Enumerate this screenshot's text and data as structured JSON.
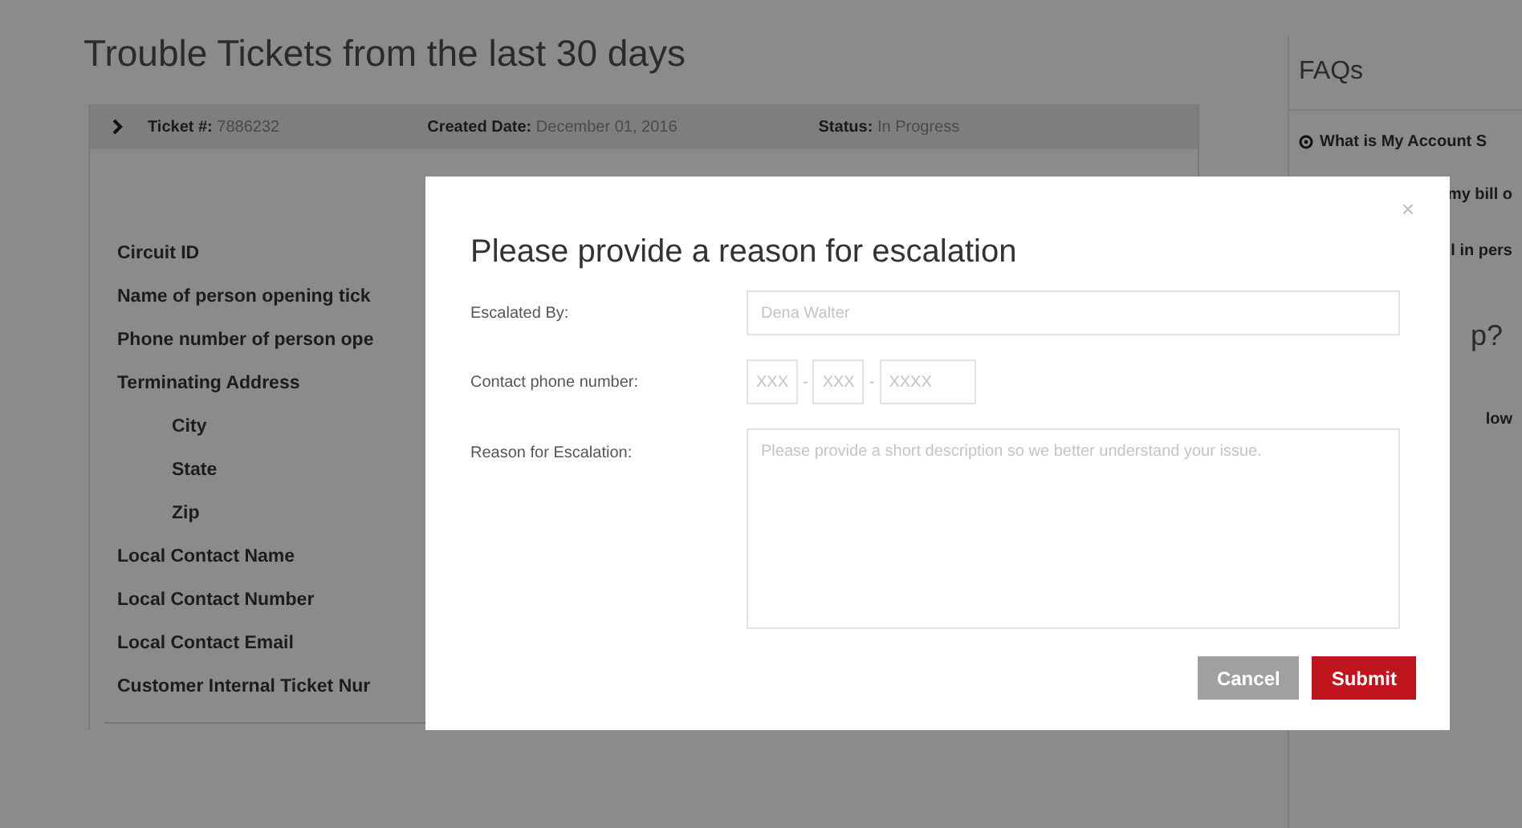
{
  "page_title": "Trouble Tickets from the last 30 days",
  "ticket": {
    "expanded": false,
    "number_label": "Ticket #:",
    "number": "7886232",
    "created_label": "Created Date:",
    "created": "December 01, 2016",
    "status_label": "Status:",
    "status": "In Progress"
  },
  "details": [
    {
      "label": "Circuit ID"
    },
    {
      "label": "Name of person opening tick"
    },
    {
      "label": "Phone number of person ope"
    },
    {
      "label": "Terminating Address",
      "children": [
        {
          "label": "City"
        },
        {
          "label": "State"
        },
        {
          "label": "Zip"
        }
      ]
    },
    {
      "label": "Local Contact Name"
    },
    {
      "label": "Local Contact Number"
    },
    {
      "label": "Local Contact Email"
    },
    {
      "label": "Customer Internal Ticket Nur"
    }
  ],
  "faqs": {
    "title": "FAQs",
    "items": [
      {
        "kind": "question",
        "text": "What is My Account S"
      },
      {
        "kind": "fragment",
        "text": "my bill o"
      },
      {
        "kind": "fragment",
        "text": "l in pers"
      },
      {
        "kind": "heading",
        "text": "p?"
      },
      {
        "kind": "fragment",
        "text": "low"
      }
    ]
  },
  "modal": {
    "close": "×",
    "title": "Please provide a reason for escalation",
    "escalated_by": {
      "label": "Escalated By:",
      "placeholder": "Dena Walter"
    },
    "phone": {
      "label": "Contact phone number:",
      "parts": [
        {
          "placeholder": "XXX"
        },
        {
          "placeholder": "XXX"
        },
        {
          "placeholder": "XXXX"
        }
      ],
      "separators": [
        "-",
        "-"
      ]
    },
    "reason": {
      "label": "Reason for Escalation:",
      "placeholder": "Please provide a short description so we better understand your issue."
    },
    "buttons": [
      {
        "kind": "cancel",
        "label": "Cancel",
        "disabled": true
      },
      {
        "kind": "submit",
        "label": "Submit",
        "disabled": false
      }
    ]
  }
}
